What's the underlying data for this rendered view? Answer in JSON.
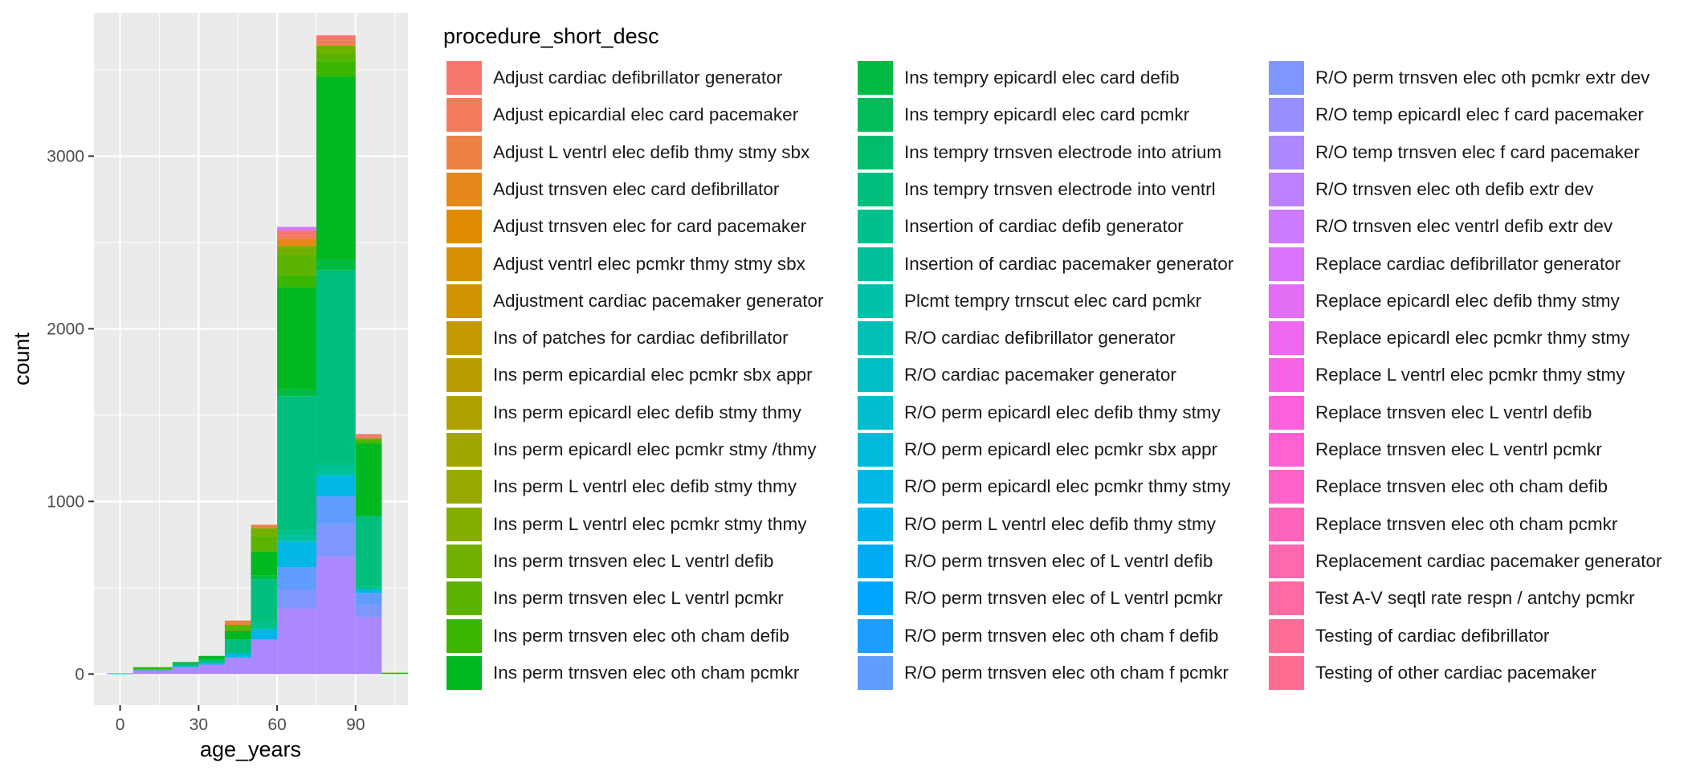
{
  "chart_data": {
    "type": "bar",
    "subtype": "stacked histogram",
    "xlabel": "age_years",
    "ylabel": "count",
    "xlim": [
      -10,
      110
    ],
    "ylim": [
      -180,
      3830
    ],
    "x_ticks": [
      0,
      30,
      60,
      90
    ],
    "y_ticks": [
      0,
      1000,
      2000,
      3000
    ],
    "grid": true,
    "legend_position": "right",
    "legend_title": "procedure_short_desc",
    "bins": [
      {
        "x0": -5,
        "x1": 5,
        "total": 5
      },
      {
        "x0": 5,
        "x1": 20,
        "total": 40
      },
      {
        "x0": 20,
        "x1": 30,
        "total": 70
      },
      {
        "x0": 30,
        "x1": 40,
        "total": 105
      },
      {
        "x0": 40,
        "x1": 50,
        "total": 310
      },
      {
        "x0": 50,
        "x1": 60,
        "total": 865
      },
      {
        "x0": 60,
        "x1": 75,
        "total": 2590
      },
      {
        "x0": 75,
        "x1": 90,
        "total": 3650
      },
      {
        "x0": 90,
        "x1": 100,
        "total": 1390
      },
      {
        "x0": 100,
        "x1": 110,
        "total": 8
      }
    ],
    "stacks": [
      [
        {
          "c": 28,
          "v": 3
        },
        {
          "c": 38,
          "v": 2
        }
      ],
      [
        {
          "c": 36,
          "v": 22
        },
        {
          "c": 20,
          "v": 6
        },
        {
          "c": 15,
          "v": 12
        }
      ],
      [
        {
          "c": 36,
          "v": 40
        },
        {
          "c": 27,
          "v": 8
        },
        {
          "c": 19,
          "v": 15
        },
        {
          "c": 16,
          "v": 7
        }
      ],
      [
        {
          "c": 36,
          "v": 55
        },
        {
          "c": 28,
          "v": 10
        },
        {
          "c": 20,
          "v": 20
        },
        {
          "c": 16,
          "v": 20
        }
      ],
      [
        {
          "c": 36,
          "v": 95
        },
        {
          "c": 28,
          "v": 25
        },
        {
          "c": 20,
          "v": 80
        },
        {
          "c": 16,
          "v": 50
        },
        {
          "c": 14,
          "v": 35
        },
        {
          "c": 2,
          "v": 25
        }
      ],
      [
        {
          "c": 36,
          "v": 200
        },
        {
          "c": 29,
          "v": 20
        },
        {
          "c": 28,
          "v": 40
        },
        {
          "c": 21,
          "v": 40
        },
        {
          "c": 20,
          "v": 250
        },
        {
          "c": 17,
          "v": 20
        },
        {
          "c": 16,
          "v": 140
        },
        {
          "c": 14,
          "v": 90
        },
        {
          "c": 13,
          "v": 45
        },
        {
          "c": 2,
          "v": 20
        }
      ],
      [
        {
          "c": 36,
          "v": 380
        },
        {
          "c": 34,
          "v": 110
        },
        {
          "c": 33,
          "v": 130
        },
        {
          "c": 28,
          "v": 140
        },
        {
          "c": 27,
          "v": 10
        },
        {
          "c": 22,
          "v": 30
        },
        {
          "c": 21,
          "v": 30
        },
        {
          "c": 20,
          "v": 780
        },
        {
          "c": 17,
          "v": 40
        },
        {
          "c": 16,
          "v": 590
        },
        {
          "c": 15,
          "v": 70
        },
        {
          "c": 14,
          "v": 120
        },
        {
          "c": 13,
          "v": 50
        },
        {
          "c": 3,
          "v": 40
        },
        {
          "c": 1,
          "v": 20
        },
        {
          "c": 0,
          "v": 30
        }
      ],
      [
        {
          "c": 36,
          "v": 680
        },
        {
          "c": 34,
          "v": 190
        },
        {
          "c": 33,
          "v": 160
        },
        {
          "c": 28,
          "v": 120
        },
        {
          "c": 22,
          "v": 40
        },
        {
          "c": 21,
          "v": 30
        },
        {
          "c": 20,
          "v": 1120
        },
        {
          "c": 17,
          "v": 60
        },
        {
          "c": 16,
          "v": 1060
        },
        {
          "c": 15,
          "v": 90
        },
        {
          "c": 14,
          "v": 50
        },
        {
          "c": 13,
          "v": 40
        },
        {
          "c": 2,
          "v": 10
        },
        {
          "c": 1,
          "v": 20
        },
        {
          "c": 0,
          "v": 30
        }
      ],
      [
        {
          "c": 36,
          "v": 330
        },
        {
          "c": 34,
          "v": 70
        },
        {
          "c": 33,
          "v": 70
        },
        {
          "c": 28,
          "v": 20
        },
        {
          "c": 21,
          "v": 15
        },
        {
          "c": 20,
          "v": 410
        },
        {
          "c": 16,
          "v": 420
        },
        {
          "c": 15,
          "v": 15
        },
        {
          "c": 14,
          "v": 15
        },
        {
          "c": 1,
          "v": 10
        },
        {
          "c": 0,
          "v": 15
        }
      ],
      [
        {
          "c": 16,
          "v": 5
        },
        {
          "c": 15,
          "v": 3
        }
      ]
    ],
    "categories": [
      "Adjust cardiac defibrillator generator",
      "Adjust epicardial elec card pacemaker",
      "Adjust L ventrl elec defib thmy stmy sbx",
      "Adjust trnsven elec card defibrillator",
      "Adjust trnsven elec for card pacemaker",
      "Adjust ventrl elec pcmkr thmy stmy sbx",
      "Adjustment cardiac pacemaker generator",
      "Ins of patches for cardiac defibrillator",
      "Ins perm epicardial elec pcmkr sbx appr",
      "Ins perm epicardl elec defib stmy thmy",
      "Ins perm epicardl elec pcmkr stmy /thmy",
      "Ins perm L ventrl elec defib stmy thmy",
      "Ins perm L ventrl elec pcmkr stmy thmy",
      "Ins perm trnsven elec L ventrl defib",
      "Ins perm trnsven elec L ventrl pcmkr",
      "Ins perm trnsven elec oth cham defib",
      "Ins perm trnsven elec oth cham pcmkr",
      "Ins tempry epicardl elec card defib",
      "Ins tempry epicardl elec card pcmkr",
      "Ins tempry trnsven electrode into atrium",
      "Ins tempry trnsven electrode into ventrl",
      "Insertion of cardiac defib generator",
      "Insertion of cardiac pacemaker generator",
      "Plcmt tempry trnscut elec card pcmkr",
      "R/O cardiac defibrillator generator",
      "R/O cardiac pacemaker generator",
      "R/O perm epicardl elec defib thmy stmy",
      "R/O perm epicardl elec pcmkr sbx appr",
      "R/O perm epicardl elec pcmkr thmy stmy",
      "R/O perm L ventrl elec defib thmy stmy",
      "R/O perm trnsven elec of L ventrl defib",
      "R/O perm trnsven elec of L ventrl pcmkr",
      "R/O perm trnsven elec oth cham f defib",
      "R/O perm trnsven elec oth cham f pcmkr",
      "R/O perm trnsven elec oth pcmkr extr dev",
      "R/O temp epicardl elec f card pacemaker",
      "R/O temp trnsven elec f card pacemaker",
      "R/O trnsven elec oth defib extr dev",
      "R/O trnsven elec ventrl defib extr dev",
      "Replace cardiac defibrillator generator",
      "Replace epicardl elec defib thmy stmy",
      "Replace epicardl elec pcmkr thmy stmy",
      "Replace L ventrl elec pcmkr thmy stmy",
      "Replace trnsven elec L ventrl defib",
      "Replace trnsven elec L ventrl pcmkr",
      "Replace trnsven elec oth cham defib",
      "Replace trnsven elec oth cham pcmkr",
      "Replacement cardiac pacemaker generator",
      "Test A-V seqtl rate respn / antchy pcmkr",
      "Testing of cardiac defibrillator",
      "Testing of other cardiac pacemaker"
    ],
    "colors": [
      "#F8766D",
      "#F37B59",
      "#ED8141",
      "#E7861B",
      "#E08B00",
      "#D89000",
      "#CF9400",
      "#C59900",
      "#BB9D00",
      "#B0A100",
      "#A3A500",
      "#95A900",
      "#85AD00",
      "#72B000",
      "#5BB300",
      "#39B600",
      "#00B81F",
      "#00BA42",
      "#00BC59",
      "#00BD6D",
      "#00BF7D",
      "#00C08D",
      "#00C19C",
      "#00C1AA",
      "#00C0B7",
      "#00BFC4",
      "#00BDD0",
      "#00BADB",
      "#00B7E5",
      "#00B2EE",
      "#00ACF6",
      "#00A5FF",
      "#1E9DFF",
      "#619CFF",
      "#7F96FF",
      "#978FFF",
      "#AC88FF",
      "#BD81FF",
      "#CC7AFF",
      "#D973FC",
      "#E46DF6",
      "#EE67EE",
      "#F663E6",
      "#FC61DD",
      "#FF61D3",
      "#FF62C8",
      "#FF64BC",
      "#FF67AF",
      "#FF6AA2",
      "#FF6C95",
      "#FF6C91"
    ]
  }
}
